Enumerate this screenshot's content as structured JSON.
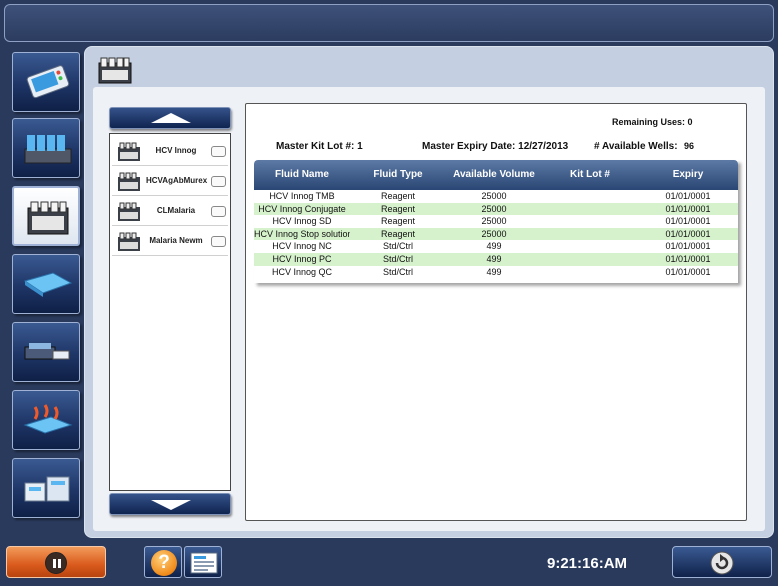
{
  "nav": {
    "items": [
      {
        "name": "instrument-icon"
      },
      {
        "name": "reagent-rack-icon"
      },
      {
        "name": "kit-icon"
      },
      {
        "name": "plate-icon"
      },
      {
        "name": "washer-icon"
      },
      {
        "name": "incubator-icon"
      },
      {
        "name": "storage-icon"
      }
    ],
    "active_index": 2
  },
  "kits": {
    "items": [
      {
        "label": "HCV Innog"
      },
      {
        "label": "HCVAgAbMurex"
      },
      {
        "label": "CLMalaria"
      },
      {
        "label": "Malaria Newm"
      }
    ]
  },
  "details": {
    "remaining_uses": "Remaining Uses: 0",
    "master_kit_lot": "Master Kit Lot #: 1",
    "master_expiry": "Master Expiry Date: 12/27/2013",
    "available_wells_label": "# Available Wells:",
    "available_wells_value": "96"
  },
  "fluid_table": {
    "headers": [
      "Fluid Name",
      "Fluid Type",
      "Available Volume",
      "Kit Lot #",
      "Expiry"
    ],
    "rows": [
      {
        "name": "HCV Innog TMB",
        "type": "Reagent",
        "volume": "25000",
        "lot": "",
        "expiry": "01/01/0001"
      },
      {
        "name": "HCV Innog Conjugate",
        "type": "Reagent",
        "volume": "25000",
        "lot": "",
        "expiry": "01/01/0001"
      },
      {
        "name": "HCV Innog SD",
        "type": "Reagent",
        "volume": "25000",
        "lot": "",
        "expiry": "01/01/0001"
      },
      {
        "name": "HCV Innog Stop solution",
        "type": "Reagent",
        "volume": "25000",
        "lot": "",
        "expiry": "01/01/0001"
      },
      {
        "name": "HCV Innog NC",
        "type": "Std/Ctrl",
        "volume": "499",
        "lot": "",
        "expiry": "01/01/0001"
      },
      {
        "name": "HCV Innog PC",
        "type": "Std/Ctrl",
        "volume": "499",
        "lot": "",
        "expiry": "01/01/0001"
      },
      {
        "name": "HCV Innog QC",
        "type": "Std/Ctrl",
        "volume": "499",
        "lot": "",
        "expiry": "01/01/0001"
      }
    ]
  },
  "bottom_bar": {
    "help_glyph": "?",
    "clock": "9:21:16:AM"
  },
  "colors": {
    "accent_orange": "#d95a1c",
    "table_header": "#2a4674",
    "row_highlight": "#d6f2cc",
    "chrome_blue": "#2a3a5c"
  }
}
